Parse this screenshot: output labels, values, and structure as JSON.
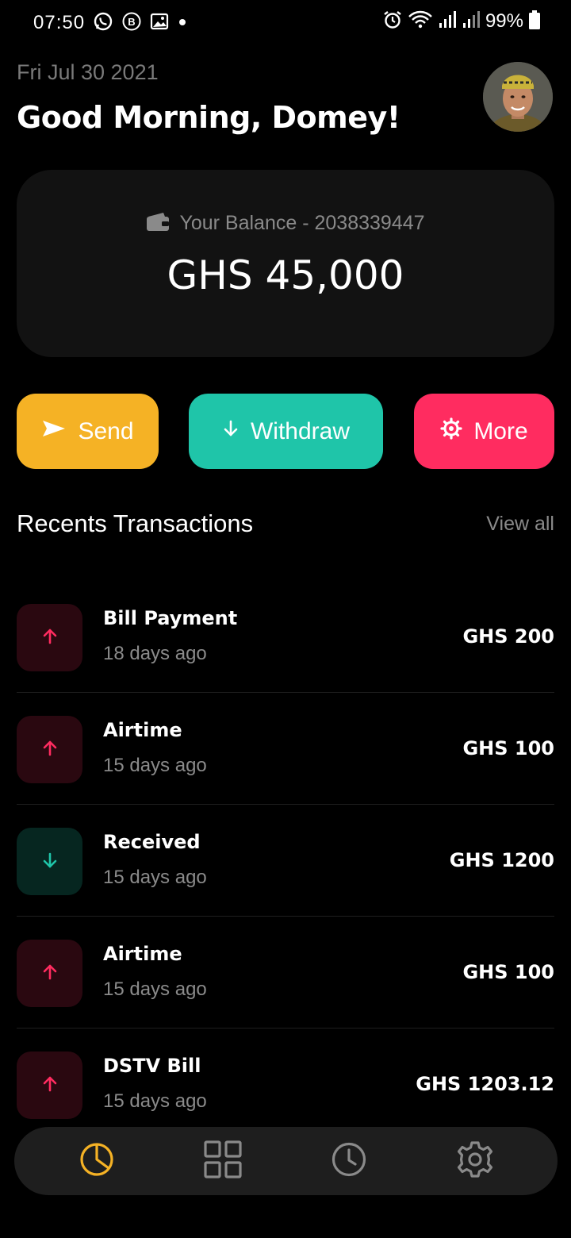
{
  "status_bar": {
    "time": "07:50",
    "battery": "99%",
    "left_icons": [
      "whatsapp-icon",
      "b-badge-icon",
      "gallery-icon",
      "dot-icon"
    ],
    "right_icons": [
      "alarm-icon",
      "wifi-icon",
      "signal-icon",
      "signal-icon",
      "battery-icon"
    ]
  },
  "header": {
    "date": "Fri Jul 30 2021",
    "greeting": "Good Morning, Domey!"
  },
  "balance": {
    "label": "Your Balance - 2038339447",
    "amount": "GHS 45,000",
    "icon": "wallet-icon"
  },
  "actions": {
    "send": "Send",
    "withdraw": "Withdraw",
    "more": "More"
  },
  "recents": {
    "title": "Recents Transactions",
    "view_all": "View all"
  },
  "transactions": [
    {
      "title": "Bill Payment",
      "time": "18 days ago",
      "amount": "GHS 200",
      "direction": "out"
    },
    {
      "title": "Airtime",
      "time": "15 days ago",
      "amount": "GHS 100",
      "direction": "out"
    },
    {
      "title": "Received",
      "time": "15 days ago",
      "amount": "GHS 1200",
      "direction": "in"
    },
    {
      "title": "Airtime",
      "time": "15 days ago",
      "amount": "GHS 100",
      "direction": "out"
    },
    {
      "title": "DSTV Bill",
      "time": "15 days ago",
      "amount": "GHS 1203.12",
      "direction": "out"
    }
  ],
  "nav": {
    "items": [
      "pie-chart-icon",
      "grid-icon",
      "clock-icon",
      "gear-icon"
    ],
    "active": "pie-chart-icon"
  },
  "colors": {
    "background": "#000000",
    "card": "#121212",
    "send": "#f5b225",
    "withdraw": "#1fc5a9",
    "more": "#ff2c60",
    "outgoing_arrow": "#ff2c60",
    "incoming_arrow": "#1fc5a9",
    "nav_active": "#f5b225",
    "nav_inactive": "#8a8a8a"
  }
}
